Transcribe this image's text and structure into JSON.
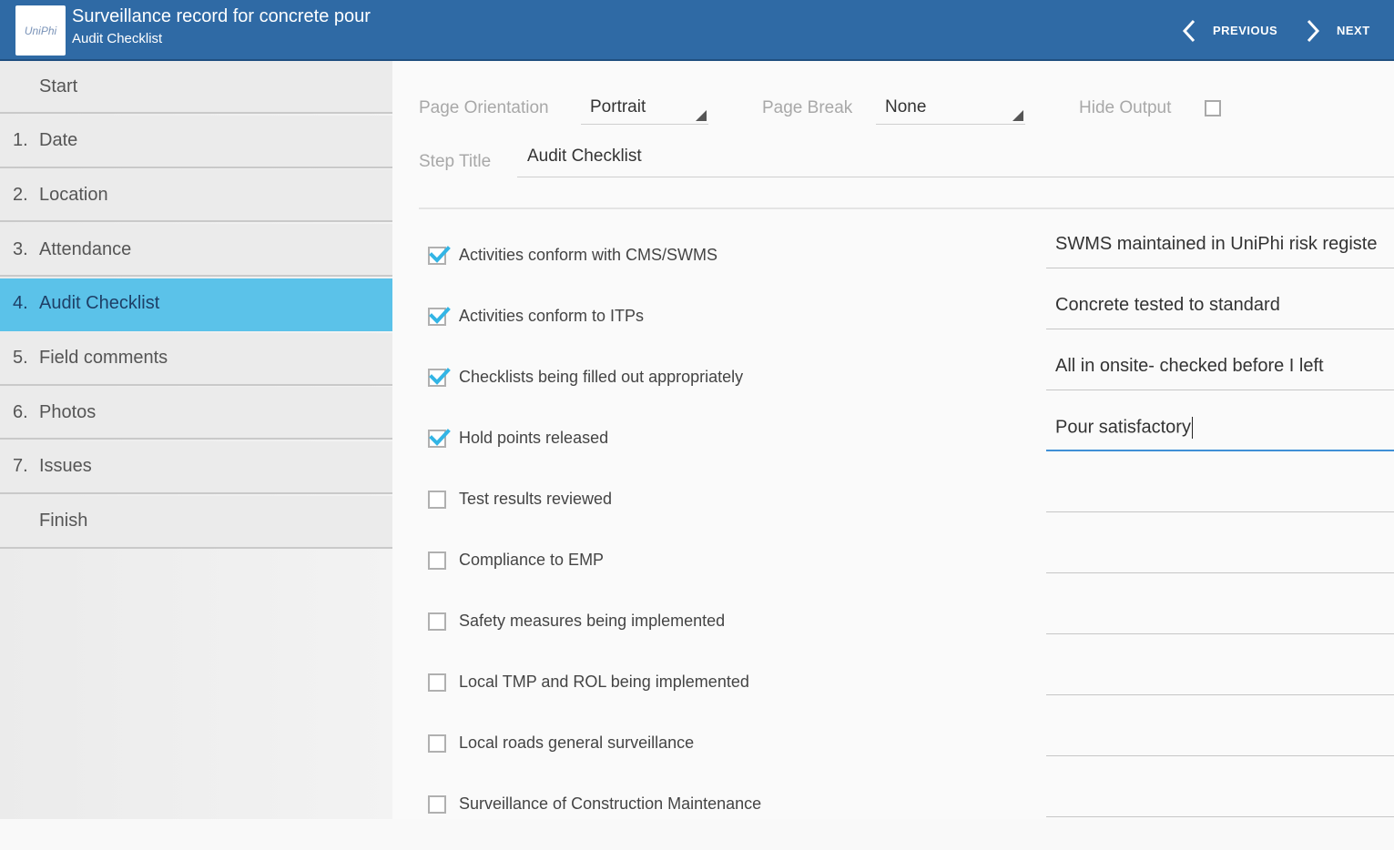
{
  "header": {
    "logo_text": "UniPhi",
    "title": "Surveillance record for concrete pour",
    "subtitle": "Audit Checklist",
    "previous_label": "PREVIOUS",
    "next_label": "NEXT",
    "bar_color": "#2f6aa5"
  },
  "sidebar": {
    "items": [
      {
        "num": "",
        "label": "Start"
      },
      {
        "num": "1.",
        "label": "Date"
      },
      {
        "num": "2.",
        "label": "Location"
      },
      {
        "num": "3.",
        "label": "Attendance"
      },
      {
        "num": "4.",
        "label": "Audit Checklist"
      },
      {
        "num": "5.",
        "label": "Field comments"
      },
      {
        "num": "6.",
        "label": "Photos"
      },
      {
        "num": "7.",
        "label": "Issues"
      },
      {
        "num": "",
        "label": "Finish"
      }
    ],
    "active_index": 4,
    "active_color": "#5bc2e9"
  },
  "settings": {
    "orientation_label": "Page Orientation",
    "orientation_value": "Portrait",
    "page_break_label": "Page Break",
    "page_break_value": "None",
    "hide_output_label": "Hide Output",
    "step_title_label": "Step Title",
    "step_title_value": "Audit Checklist"
  },
  "checklist": [
    {
      "label": "Activities conform with CMS/SWMS",
      "checked": true,
      "comment": "SWMS maintained in UniPhi risk registe"
    },
    {
      "label": "Activities conform to ITPs",
      "checked": true,
      "comment": "Concrete tested to standard"
    },
    {
      "label": "Checklists being filled out appropriately",
      "checked": true,
      "comment": "All in onsite- checked before I left"
    },
    {
      "label": "Hold points released",
      "checked": true,
      "comment": "Pour satisfactory"
    },
    {
      "label": "Test results reviewed",
      "checked": false,
      "comment": ""
    },
    {
      "label": "Compliance to EMP",
      "checked": false,
      "comment": ""
    },
    {
      "label": "Safety measures being implemented",
      "checked": false,
      "comment": ""
    },
    {
      "label": "Local TMP and ROL being implemented",
      "checked": false,
      "comment": ""
    },
    {
      "label": "Local roads general surveillance",
      "checked": false,
      "comment": ""
    },
    {
      "label": "Surveillance of Construction Maintenance",
      "checked": false,
      "comment": ""
    }
  ],
  "check_color": "#33b5e5"
}
